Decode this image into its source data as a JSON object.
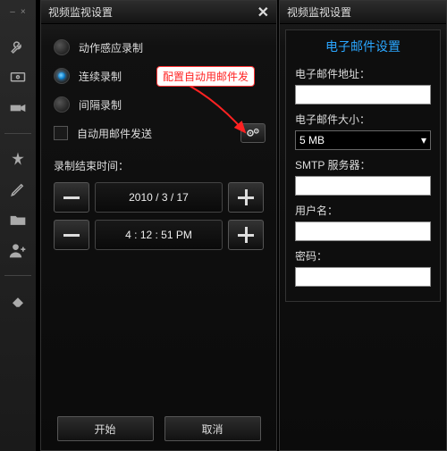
{
  "sidebar": {
    "minimize": "–",
    "close": "×"
  },
  "left": {
    "title": "视频监视设置",
    "options": {
      "motion": "动作感应录制",
      "continuous": "连续录制",
      "interval": "间隔录制",
      "autoEmail": "自动用邮件发送"
    },
    "endTimeLabel": "录制结束时间：",
    "date": "2010 /  3 / 17",
    "time": "4 : 12 : 51  PM",
    "startBtn": "开始",
    "cancelBtn": "取消"
  },
  "right": {
    "title": "视频监视设置",
    "emailTitle": "电子邮件设置",
    "fields": {
      "address": "电子邮件地址：",
      "size": "电子邮件大小：",
      "sizeValue": "5 MB",
      "smtp": "SMTP 服务器：",
      "user": "用户名：",
      "password": "密码："
    }
  },
  "callout": "配置自动用邮件发"
}
